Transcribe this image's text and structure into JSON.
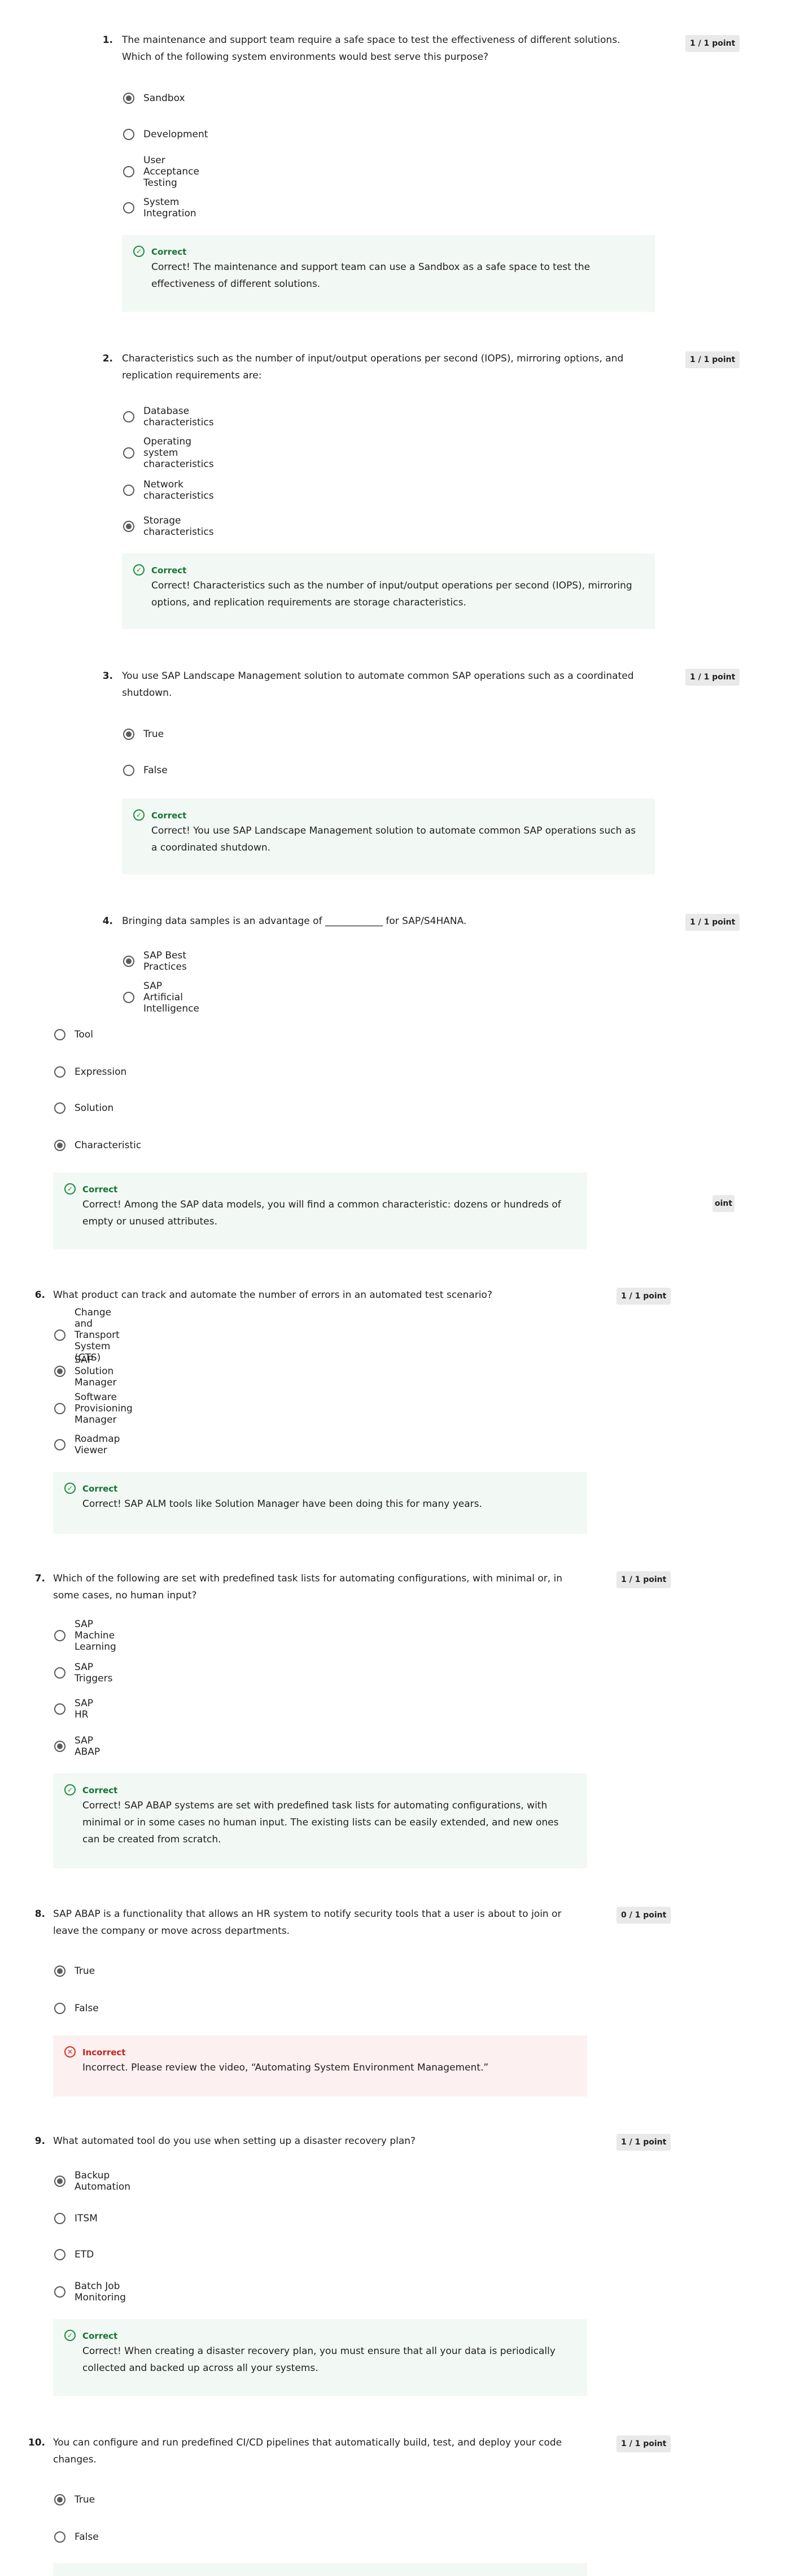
{
  "questions": [
    {
      "number": "1.",
      "text": "The maintenance and support team require a safe space to test the effectiveness of different solutions. Which of the following system environments would best serve this purpose?",
      "points": "1 / 1 point",
      "options": [
        "Sandbox",
        "Development",
        "User Acceptance Testing",
        "System Integration"
      ],
      "selected": 0,
      "feedback": {
        "status": "Correct",
        "text": "Correct! The maintenance and support team can use a Sandbox as a safe space to test the effectiveness of different solutions."
      }
    },
    {
      "number": "2.",
      "text": "Characteristics such as the number of input/output operations per second (IOPS), mirroring options, and replication requirements are:",
      "points": "1 / 1 point",
      "options": [
        "Database characteristics",
        "Operating system characteristics",
        "Network characteristics",
        "Storage characteristics"
      ],
      "selected": 3,
      "feedback": {
        "status": "Correct",
        "text": "Correct! Characteristics such as the number of input/output operations per second (IOPS), mirroring options, and replication requirements are storage characteristics."
      }
    },
    {
      "number": "3.",
      "text": "You use SAP Landscape Management solution to automate common SAP operations such as a coordinated shutdown.",
      "points": "1 / 1 point",
      "options": [
        "True",
        "False"
      ],
      "selected": 0,
      "feedback": {
        "status": "Correct",
        "text": "Correct! You use SAP Landscape Management solution to automate common SAP operations such as a coordinated shutdown."
      }
    },
    {
      "number": "4.",
      "text": "Bringing data samples is an advantage of ____________ for SAP/S4HANA.",
      "points": "1 / 1 point",
      "options": [
        "SAP Best Practices",
        "SAP Artificial Intelligence"
      ],
      "selected": 0
    },
    {
      "number": "",
      "text": "",
      "points": "oint",
      "options": [
        "Tool",
        "Expression",
        "Solution",
        "Characteristic"
      ],
      "selected": 3,
      "feedback": {
        "status": "Correct",
        "text": "Correct! Among the SAP data models, you will find a common characteristic: dozens or hundreds of empty or unused attributes."
      }
    },
    {
      "number": "6.",
      "text": "What product can track and automate the number of errors in an automated test scenario?",
      "points": "1 / 1 point",
      "options": [
        "Change and Transport System (CTS)",
        "SAP Solution Manager",
        "Software Provisioning Manager",
        "Roadmap Viewer"
      ],
      "selected": 1,
      "feedback": {
        "status": "Correct",
        "text": "Correct! SAP ALM tools like Solution Manager have been doing this for many years."
      }
    },
    {
      "number": "7.",
      "text": "Which of the following are set with predefined task lists for automating configurations, with minimal or, in some cases, no human input?",
      "points": "1 / 1 point",
      "options": [
        "SAP Machine Learning",
        "SAP Triggers",
        "SAP HR",
        "SAP ABAP"
      ],
      "selected": 3,
      "feedback": {
        "status": "Correct",
        "text": "Correct! SAP ABAP systems are set with predefined task lists for automating configurations, with minimal or in some cases no human input. The existing lists can be easily extended, and new ones can be created from scratch."
      }
    },
    {
      "number": "8.",
      "text": "SAP ABAP is a functionality that allows an HR system to notify security tools that a user is about to join or leave the company or move across departments.",
      "points": "0 / 1 point",
      "options": [
        "True",
        "False"
      ],
      "selected": 0,
      "feedback": {
        "status": "Incorrect",
        "text": "Incorrect. Please review the video, “Automating System Environment Management.”"
      }
    },
    {
      "number": "9.",
      "text": "What automated tool do you use when setting up a disaster recovery plan?",
      "points": "1 / 1 point",
      "options": [
        "Backup Automation",
        "ITSM",
        "ETD",
        "Batch Job Monitoring"
      ],
      "selected": 0,
      "feedback": {
        "status": "Correct",
        "text": "Correct! When creating a disaster recovery plan, you must ensure that all your data is periodically collected and backed up across all your systems."
      }
    },
    {
      "number": "10.",
      "text": "You can configure and run predefined CI/CD pipelines that automatically build, test, and deploy your code changes.",
      "points": "1 / 1 point",
      "options": [
        "True",
        "False"
      ],
      "selected": 0
    }
  ],
  "colors": {
    "correct": "#137333",
    "incorrect": "#c5221f",
    "correct_bg": "#f2f8f4",
    "incorrect_bg": "#fdf0f0"
  },
  "icons": {
    "correct": "check-circle-icon",
    "incorrect": "x-circle-icon"
  }
}
